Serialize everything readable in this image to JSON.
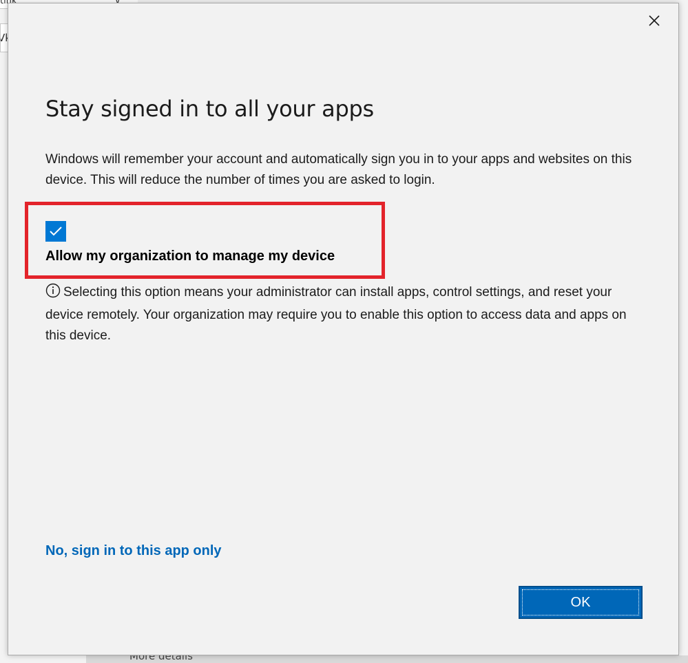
{
  "background": {
    "topbar_text": "tlnk",
    "leftbar_text": "Vk",
    "bottom_text": "More details"
  },
  "dialog": {
    "title": "Stay signed in to all your apps",
    "description": "Windows will remember your account and automatically sign you in to your apps and websites on this device. This will reduce the number of times you are asked to login.",
    "checkbox": {
      "label": "Allow my organization to manage my device",
      "checked": true
    },
    "info_text": "Selecting this option means your administrator can install apps, control settings, and reset your device remotely. Your organization may require you to enable this option to access data and apps on this device.",
    "link_label": "No, sign in to this app only",
    "ok_label": "OK"
  },
  "colors": {
    "accent": "#0078d4",
    "link": "#0067b8",
    "highlight": "#e3242b",
    "dialog_bg": "#f2f2f2"
  },
  "icons": {
    "close": "close-icon",
    "check": "checkmark-icon",
    "info": "info-icon"
  }
}
